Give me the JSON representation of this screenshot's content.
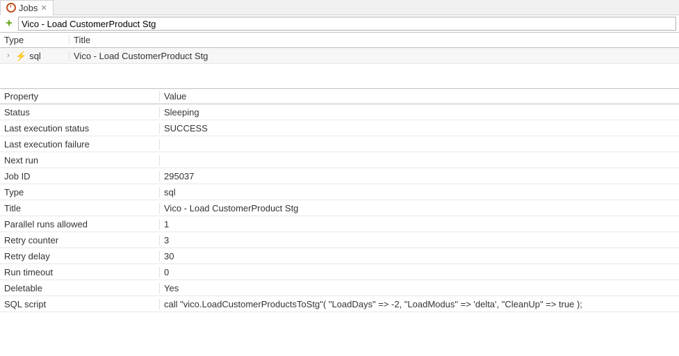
{
  "tab": {
    "title": "Jobs"
  },
  "toolbar": {
    "search_value": "Vico - Load CustomerProduct Stg"
  },
  "jobs_table": {
    "headers": {
      "type": "Type",
      "title": "Title"
    },
    "row": {
      "type": "sql",
      "title": "Vico - Load CustomerProduct Stg"
    }
  },
  "props_table": {
    "headers": {
      "property": "Property",
      "value": "Value"
    },
    "rows": [
      {
        "property": "Status",
        "value": "Sleeping"
      },
      {
        "property": "Last execution status",
        "value": "SUCCESS"
      },
      {
        "property": "Last execution failure",
        "value": ""
      },
      {
        "property": "Next run",
        "value": ""
      },
      {
        "property": "Job ID",
        "value": "295037"
      },
      {
        "property": "Type",
        "value": "sql"
      },
      {
        "property": "Title",
        "value": "Vico - Load CustomerProduct Stg"
      },
      {
        "property": "Parallel runs allowed",
        "value": "1"
      },
      {
        "property": "Retry counter",
        "value": "3"
      },
      {
        "property": "Retry delay",
        "value": "30"
      },
      {
        "property": "Run timeout",
        "value": "0"
      },
      {
        "property": "Deletable",
        "value": "Yes"
      },
      {
        "property": "SQL script",
        "value": "call \"vico.LoadCustomerProductsToStg\"(   \"LoadDays\" => -2,     \"LoadModus\" => 'delta',     \"CleanUp\" => true  );"
      }
    ]
  }
}
